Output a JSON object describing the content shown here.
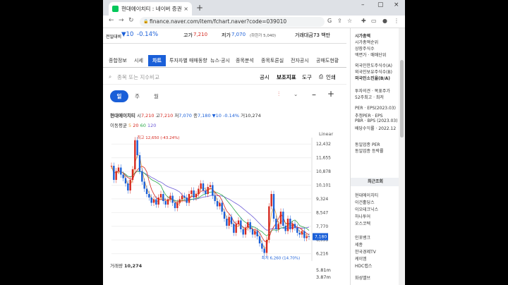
{
  "browser": {
    "tab_title": "현대에이치티 : 네이버 증권",
    "tab_close": "×",
    "new_tab": "+",
    "url": "finance.naver.com/item/fchart.naver?code=039010",
    "win_minimize": "–",
    "win_maximize": "▢",
    "win_close": "×"
  },
  "header": {
    "prev_close_label": "전일대비",
    "change": "▼10",
    "change_pct": "-0.14%",
    "high_label": "고가",
    "high": "7,210",
    "low_label": "저가",
    "low": "7,070",
    "low_limit": "(하한가 5,040)",
    "trade_value_label": "거래대금",
    "trade_value": "73 백만"
  },
  "tabs": [
    "종합정보",
    "시세",
    "차트",
    "투자자별 매매동향",
    "뉴스·공시",
    "종목분석",
    "종목토론실",
    "전자공시",
    "공매도현황"
  ],
  "active_tab": "차트",
  "toolbar": {
    "search_placeholder": "종목 또는 지수비교",
    "disclosure": "공시",
    "indicator": "보조지표",
    "tools": "도구",
    "print": "인쇄"
  },
  "period": {
    "day": "일",
    "week": "주",
    "month": "월"
  },
  "stock_info": {
    "name": "현대에이치티",
    "open_label": "시",
    "open": "7,210",
    "high_label": "고",
    "high": "7,210",
    "low_label": "저",
    "low": "7,070",
    "close_label": "종",
    "close": "7,180",
    "change": "▼10",
    "change_pct": "-0.14%",
    "vol_label": "거",
    "volume": "10,274"
  },
  "moving_avg": {
    "label": "이동평균",
    "ma5": "5",
    "ma20": "20",
    "ma60": "60",
    "ma120": "120"
  },
  "chart_data": {
    "type": "line",
    "scale": "Linear",
    "y_ticks": [
      "12,432",
      "11,655",
      "10,878",
      "10,101",
      "9,324",
      "8,547",
      "7,770",
      "6,993",
      "6,216"
    ],
    "current_price": "7,180",
    "max_annotation": "최고 12,650 (-43.24%)",
    "min_annotation": "최저 6,260 (14.70%)",
    "ylim": [
      6000,
      12800
    ],
    "values": [
      11200,
      10400,
      10900,
      11100,
      10700,
      10500,
      10200,
      9800,
      10400,
      11000,
      12650,
      11800,
      10900,
      10300,
      9900,
      9600,
      9400,
      9100,
      9300,
      9000,
      9400,
      9600,
      9200,
      9000,
      9300,
      9500,
      9100,
      8800,
      9100,
      9300,
      9500,
      9400,
      9100,
      9600,
      9800,
      9400,
      9600,
      9900,
      10200,
      9800,
      9600,
      10000,
      10100,
      9500,
      9200,
      8900,
      9100,
      8600,
      8200,
      7800,
      8300,
      7900,
      7400,
      7900,
      8100,
      7600,
      7300,
      7700,
      8000,
      7600,
      7300,
      7500,
      7200,
      6800,
      6500,
      6260,
      7000,
      8900,
      9600,
      8200,
      7600,
      7900,
      8600,
      7800,
      7500,
      8200,
      7600,
      7900,
      7700,
      7400,
      7300,
      7500,
      7100,
      7200,
      7180
    ]
  },
  "volume": {
    "label": "거래량",
    "value": "10,274",
    "ticks": [
      "5.81m",
      "3.87m"
    ]
  },
  "right_panel": {
    "market_cap": "시가총액",
    "market_cap_rank": "시가총액순위",
    "shares": "상장주식수",
    "face_value": "액면가 · 매매단위",
    "foreign_limit": "외국인한도주식수(A)",
    "foreign_held": "외국인보유주식수(B)",
    "foreign_ratio": "외국인소진율(B/A)",
    "opinion": "투자의견 · 목표주가",
    "week52": "52주최고 · 최저",
    "per_eps": "PER · EPS(2023.03)",
    "est_per": "추정PER · EPS",
    "pbr_bps": "PBR · BPS (2023.03)",
    "dividend": "배당수익률 · 2022.12",
    "sector_per": "동일업종 PER",
    "sector_change": "동일업종 등락률",
    "recent_title": "최근조회",
    "recent": [
      "현대에이치티",
      "이건홀딩스",
      "이오테크닉스",
      "하나투어",
      "오스코텍",
      "인포뱅크",
      "세종",
      "한국경제TV",
      "케이엠",
      "HDC랩스",
      "화성밸브"
    ]
  }
}
